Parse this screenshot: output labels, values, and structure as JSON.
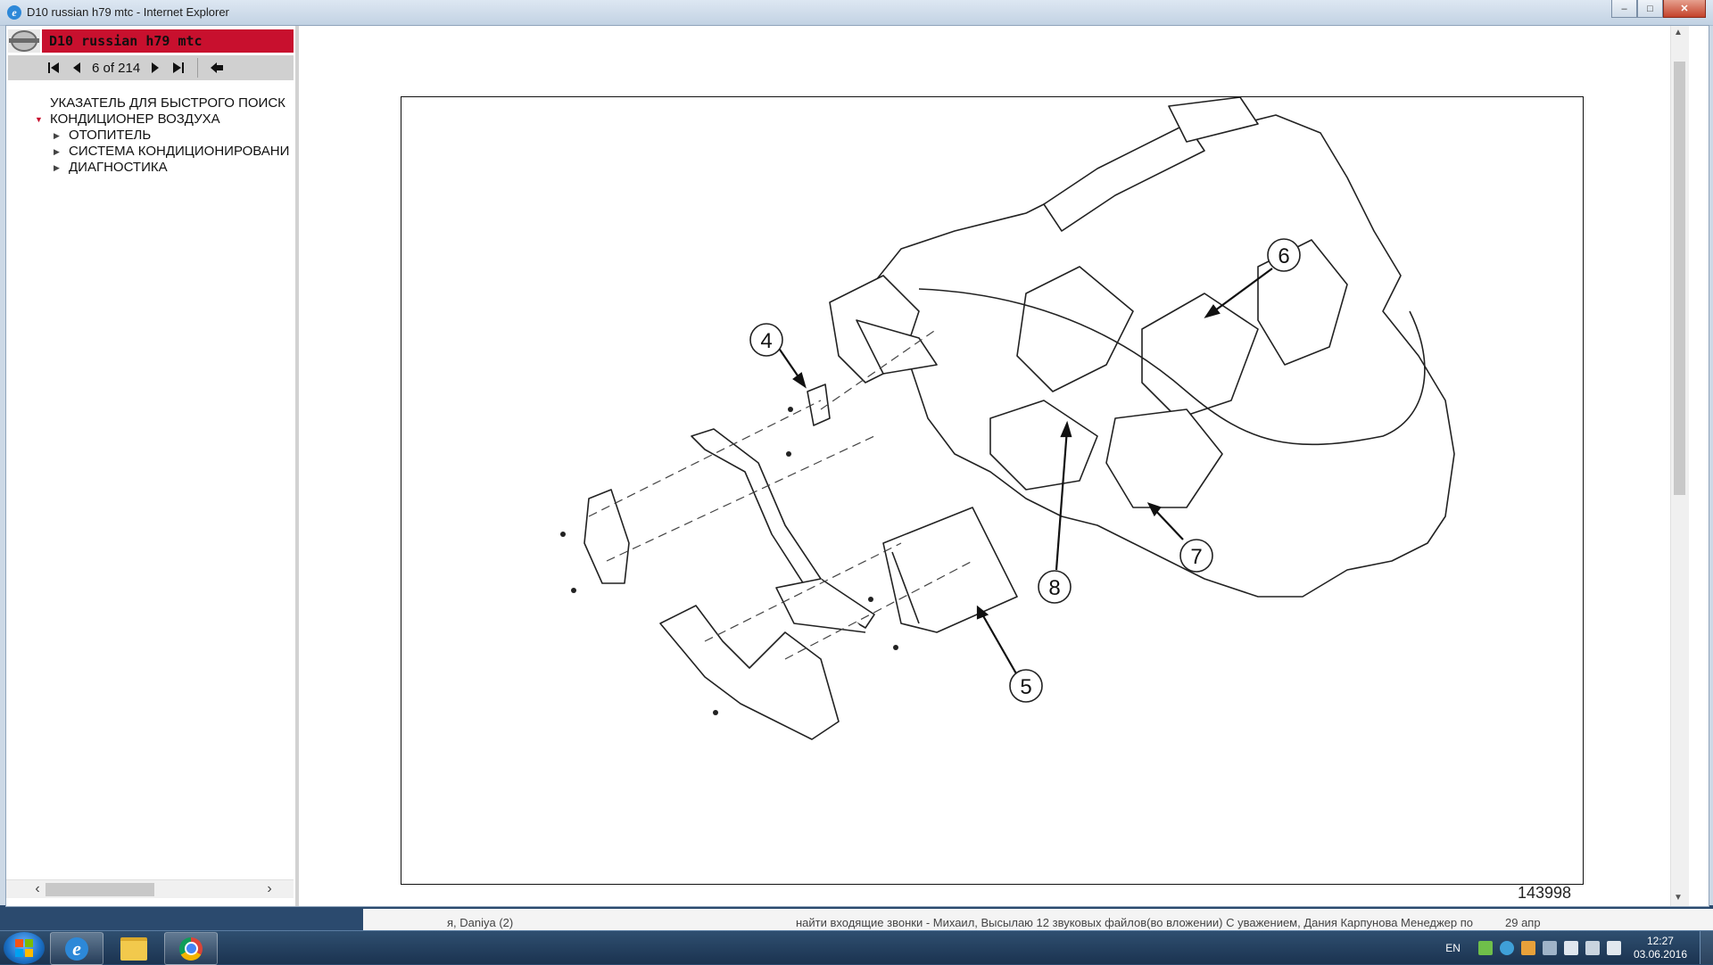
{
  "window": {
    "title": "D10 russian h79 mtc - Internet Explorer",
    "buttons": {
      "minimize": "–",
      "maximize": "□",
      "close": "✕"
    }
  },
  "sidebar": {
    "doc_title": "D10 russian h79 mtc",
    "nav": {
      "first": "⏮",
      "prev": "◀",
      "page": "6 of 214",
      "next": "▶",
      "last": "⏭",
      "back": "◀"
    },
    "toc": [
      {
        "label": "УКАЗАТЕЛЬ ДЛЯ БЫСТРОГО ПОИСК",
        "level": 0,
        "expanded": false,
        "arrow": ""
      },
      {
        "label": "КОНДИЦИОНЕР ВОЗДУХА",
        "level": 0,
        "expanded": true,
        "arrow": "▼"
      },
      {
        "label": "ОТОПИТЕЛЬ",
        "level": 1,
        "expanded": false,
        "arrow": "▶"
      },
      {
        "label": "СИСТЕМА КОНДИЦИОНИРОВАНИ",
        "level": 1,
        "expanded": false,
        "arrow": "▶"
      },
      {
        "label": "ДИАГНОСТИКА",
        "level": 1,
        "expanded": false,
        "arrow": "▶"
      }
    ],
    "hscroll": {
      "left": "‹",
      "right": "›"
    }
  },
  "figure": {
    "number": "143998",
    "callouts": [
      "4",
      "5",
      "6",
      "7",
      "8"
    ]
  },
  "background_window": {
    "sender": "я, Daniya (2)",
    "snippet": "найти входящие звонки - Михаил, Высылаю 12 звуковых файлов(во вложении) С уважением, Дания Карпунова Менеджер по",
    "date": "29 апр"
  },
  "taskbar": {
    "lang": "EN",
    "time": "12:27",
    "date": "03.06.2016"
  },
  "colors": {
    "header_red": "#c8102e",
    "taskbar": "#1b3350",
    "ie_blue": "#2d88d8"
  }
}
